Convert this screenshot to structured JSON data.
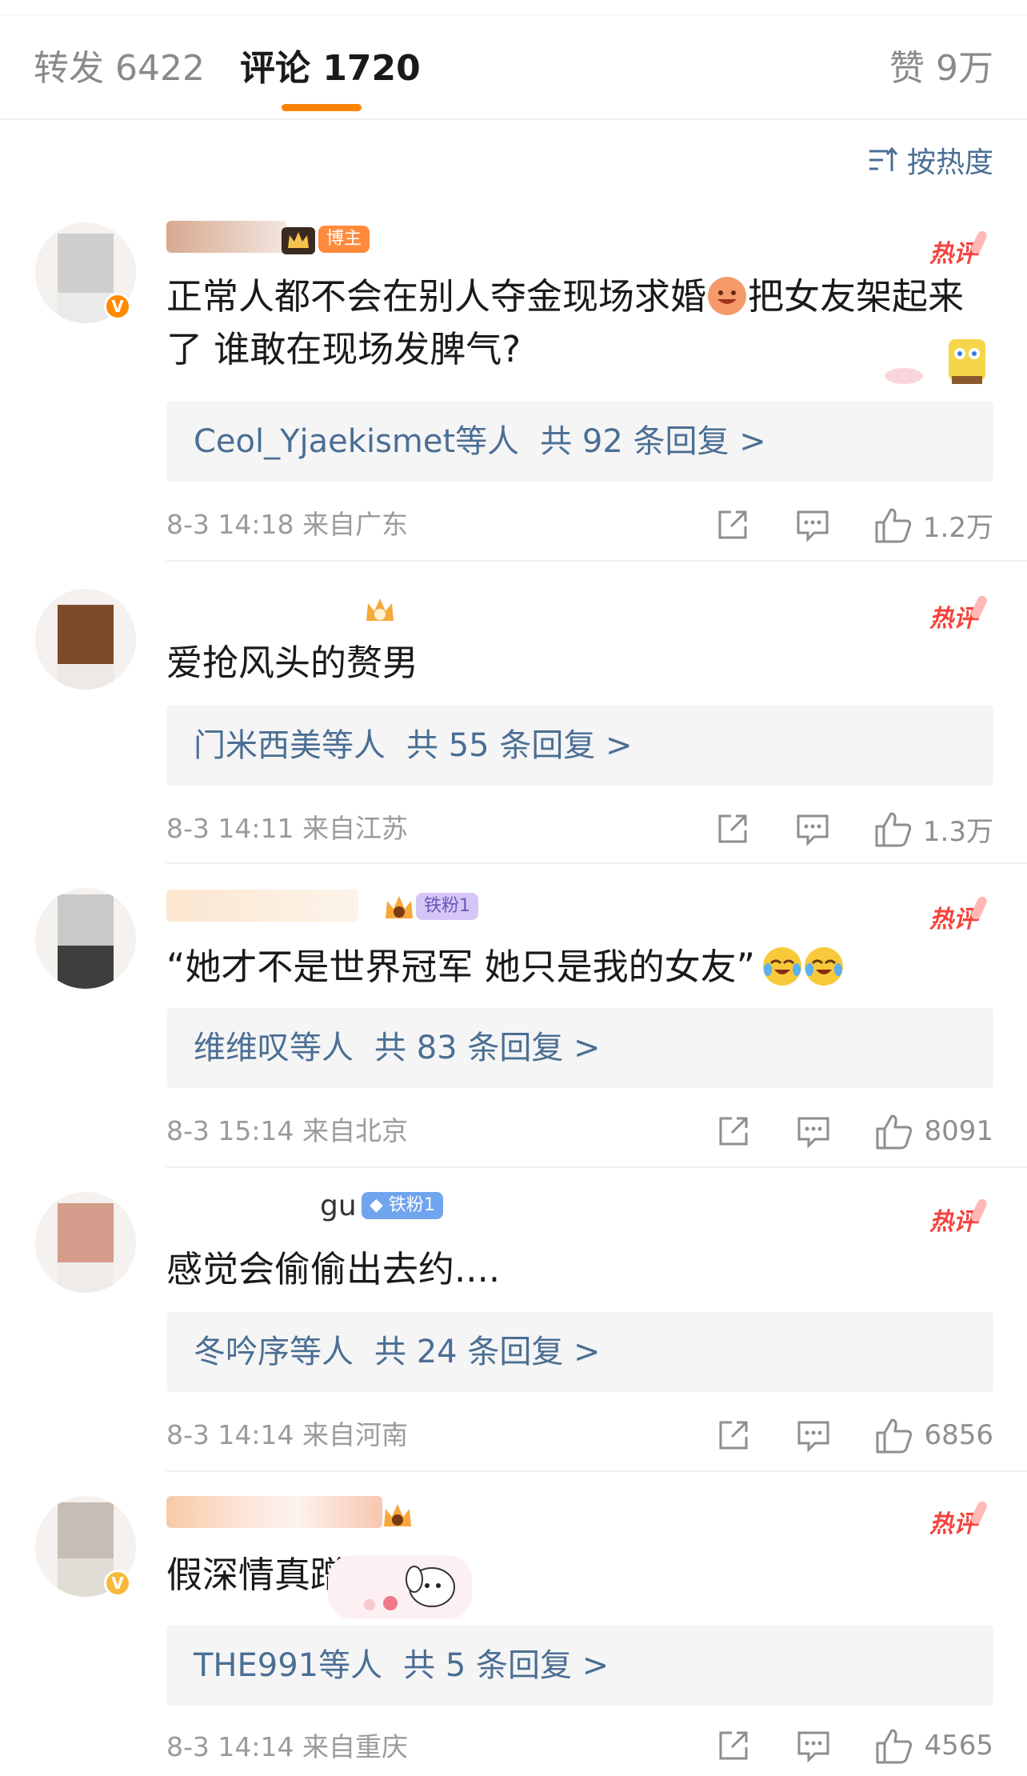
{
  "tabs": {
    "repost": "转发 6422",
    "comment": "评论 1720",
    "like": "赞 9万"
  },
  "sort_label": "按热度",
  "hot_label": "热评",
  "comments": [
    {
      "badge": "博主",
      "text_part1": "正常人都不会在别人夺金现场求婚",
      "text_part2": "把女友架起来了 谁敢在现场发脾气?",
      "reply_names": "Ceol_Yjaekismet",
      "reply_etc": "等人",
      "reply_total": "共 92 条回复 >",
      "meta": "8-3 14:18  来自广东",
      "likes": "1.2万"
    },
    {
      "text": "爱抢风头的赘男",
      "reply_names": "门米西美",
      "reply_etc": "等人",
      "reply_total": "共 55 条回复 >",
      "meta": "8-3 14:11  来自江苏",
      "likes": "1.3万"
    },
    {
      "badge": "铁粉1",
      "text": "“她才不是世界冠军 她只是我的女友”",
      "reply_names": "维维叹",
      "reply_etc": "等人",
      "reply_total": "共 83 条回复 >",
      "meta": "8-3 15:14  来自北京",
      "likes": "8091"
    },
    {
      "name_fragment": "gu",
      "badge": "铁粉1",
      "text": "感觉会偷偷出去约....",
      "reply_names": "冬吟序",
      "reply_etc": "等人",
      "reply_total": "共 24 条回复 >",
      "meta": "8-3 14:14  来自河南",
      "likes": "6856"
    },
    {
      "text": "假深情真蹭货",
      "reply_names": "THE991",
      "reply_etc": "等人",
      "reply_total": "共 5 条回复 >",
      "meta": "8-3 14:14  来自重庆",
      "likes": "4565"
    }
  ],
  "icons": {
    "sort": "sort-icon",
    "repost": "share-icon",
    "reply": "comment-icon",
    "like": "thumbs-up-icon",
    "verified": "verified-icon",
    "crown": "crown-icon"
  },
  "colors": {
    "accent": "#ff8200",
    "link": "#4b6e94",
    "hot": "#f5433c",
    "verified_orange": "#ff8a00",
    "verified_gold": "#f6b93b"
  }
}
